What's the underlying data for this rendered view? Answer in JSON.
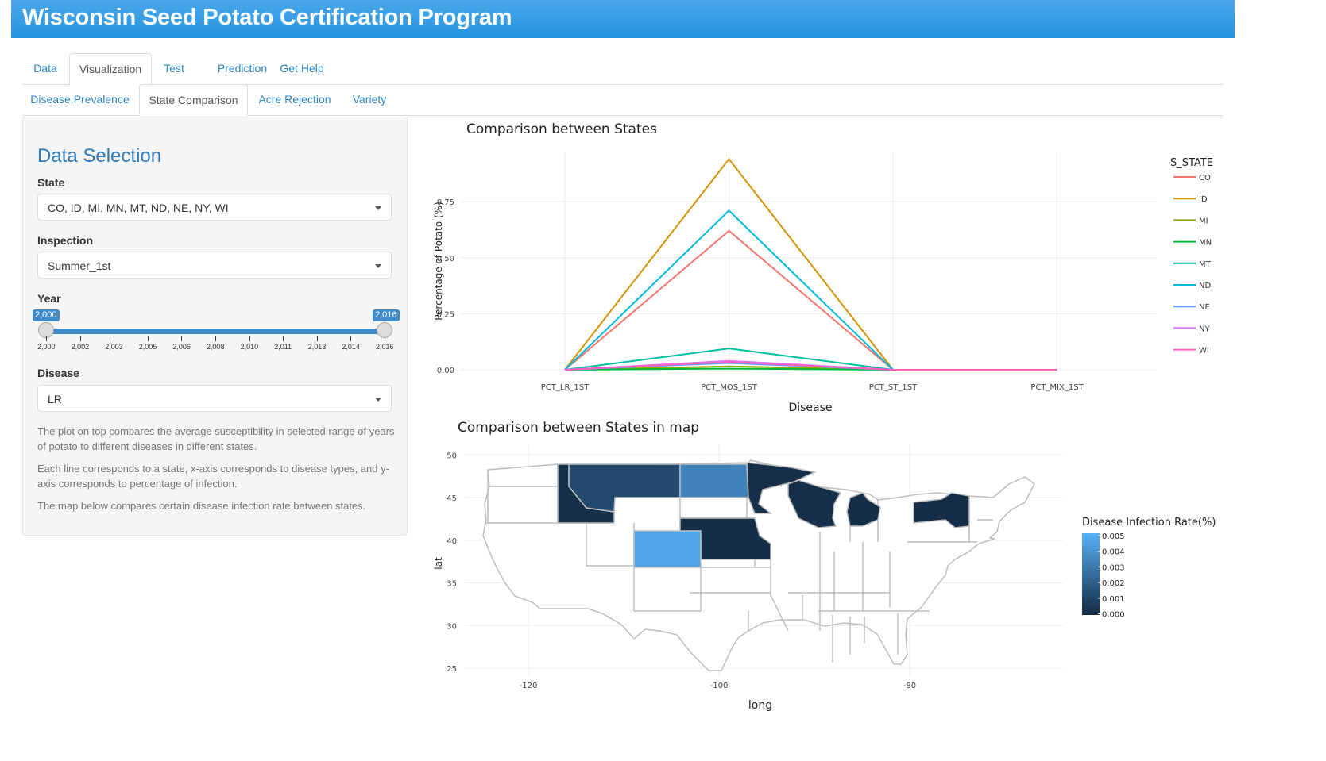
{
  "header": {
    "title": "Wisconsin Seed Potato Certification Program"
  },
  "main_tabs": [
    "Data",
    "Visualization",
    "Test",
    "Prediction",
    "Get Help"
  ],
  "sub_tabs": [
    "Disease Prevalence",
    "State Comparison",
    "Acre Rejection",
    "Variety"
  ],
  "sidebar": {
    "title": "Data Selection",
    "state_label": "State",
    "state_value": "CO, ID, MI, MN, MT, ND, NE, NY, WI",
    "inspection_label": "Inspection",
    "inspection_value": "Summer_1st",
    "year_label": "Year",
    "year_min_badge": "2,000",
    "year_max_badge": "2,016",
    "year_ticks": [
      "2,000",
      "2,002",
      "2,003",
      "2,005",
      "2,006",
      "2,008",
      "2,010",
      "2,011",
      "2,013",
      "2,014",
      "2,016"
    ],
    "disease_label": "Disease",
    "disease_value": "LR",
    "help1": "The plot on top compares the average susceptibility in selected range of years of potato to different diseases in different states.",
    "help2": "Each line corresponds to a state, x-axis corresponds to disease types, and y-axis corresponds to percentage of infection.",
    "help3": "The map below compares certain disease infection rate between states."
  },
  "chart_data": [
    {
      "type": "line",
      "title": "Comparison between States",
      "xlabel": "Disease",
      "ylabel": "Percentage of Potato (%)",
      "categories": [
        "PCT_LR_1ST",
        "PCT_MOS_1ST",
        "PCT_ST_1ST",
        "PCT_MIX_1ST"
      ],
      "yticks": [
        "0.00",
        "0.25",
        "0.50",
        "0.75"
      ],
      "ylim": [
        0,
        0.97
      ],
      "legend_title": "S_STATE",
      "legend_position": "right",
      "grid": true,
      "series": [
        {
          "name": "CO",
          "color": "#f8766d",
          "values": [
            0,
            0.62,
            0,
            0
          ]
        },
        {
          "name": "ID",
          "color": "#d39200",
          "values": [
            0,
            0.94,
            0,
            0
          ]
        },
        {
          "name": "MI",
          "color": "#93aa00",
          "values": [
            0,
            0.015,
            0,
            0
          ]
        },
        {
          "name": "MN",
          "color": "#00ba38",
          "values": [
            0,
            0.005,
            0,
            0
          ]
        },
        {
          "name": "MT",
          "color": "#00c19f",
          "values": [
            0,
            0.095,
            0,
            0
          ]
        },
        {
          "name": "ND",
          "color": "#00b9e3",
          "values": [
            0,
            0.71,
            0,
            0
          ]
        },
        {
          "name": "NE",
          "color": "#619cff",
          "values": [
            0,
            0.03,
            0,
            0
          ]
        },
        {
          "name": "NY",
          "color": "#db72fb",
          "values": [
            0,
            0.04,
            0,
            0
          ]
        },
        {
          "name": "WI",
          "color": "#ff61c3",
          "values": [
            0,
            0.035,
            0,
            0
          ]
        }
      ]
    },
    {
      "type": "heatmap",
      "title": "Comparison between States in map",
      "xlabel": "long",
      "ylabel": "lat",
      "xticks": [
        "-120",
        "-100",
        "-80"
      ],
      "yticks": [
        "25",
        "30",
        "35",
        "40",
        "45",
        "50"
      ],
      "colorbar_title": "Disease Infection Rate(%)",
      "colorbar_ticks": [
        "0.005",
        "0.004",
        "0.003",
        "0.002",
        "0.001",
        "0.000"
      ],
      "colorbar_range": [
        0,
        0.005
      ],
      "states": [
        {
          "name": "CO",
          "value": 0.0045
        },
        {
          "name": "ID",
          "value": 0.0002
        },
        {
          "name": "MI",
          "value": 0.0001
        },
        {
          "name": "MN",
          "value": 0.0002
        },
        {
          "name": "MT",
          "value": 0.0012
        },
        {
          "name": "ND",
          "value": 0.0033
        },
        {
          "name": "NE",
          "value": 0.0001
        },
        {
          "name": "NY",
          "value": 0.0001
        },
        {
          "name": "WI",
          "value": 0.0002
        }
      ]
    }
  ]
}
